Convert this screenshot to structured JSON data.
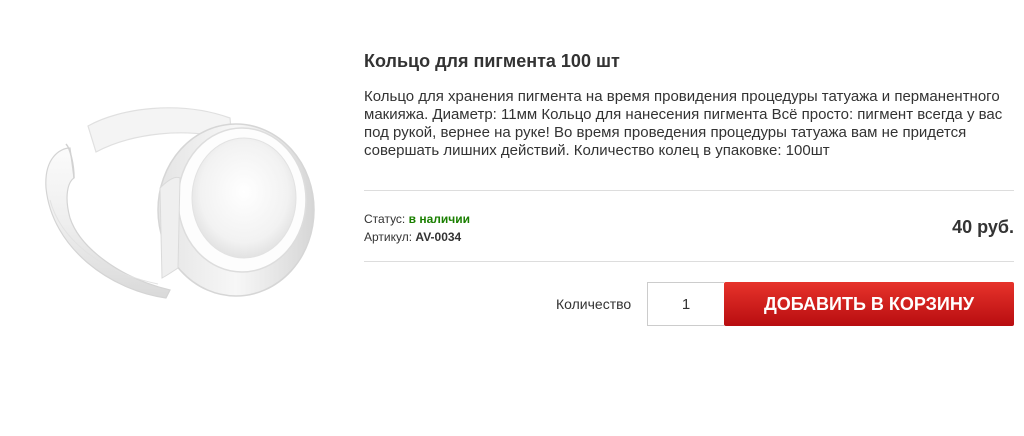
{
  "product": {
    "title": "Кольцо для пигмента 100 шт",
    "description": "Кольцо для хранения пигмента на время провидения процедуры татуажа и перманентного макияжа. Диаметр: 11мм Кольцо для нанесения пигмента Всё просто: пигмент всегда у вас под рукой, вернее на руке! Во время проведения процедуры татуажа вам не придется совершать лишних действий. Количество колец в упаковке: 100шт",
    "image_icon": "pigment-ring-image",
    "status_label": "Статус:",
    "status_value": "в наличии",
    "sku_label": "Артикул:",
    "sku_value": "AV-0034",
    "price": "40 руб."
  },
  "purchase": {
    "quantity_label": "Количество",
    "quantity_value": "1",
    "add_to_cart_label": "ДОБАВИТЬ В КОРЗИНУ"
  },
  "colors": {
    "status_in_stock": "#1a7f00",
    "button_top": "#e7332b",
    "button_bottom": "#b80d10"
  }
}
